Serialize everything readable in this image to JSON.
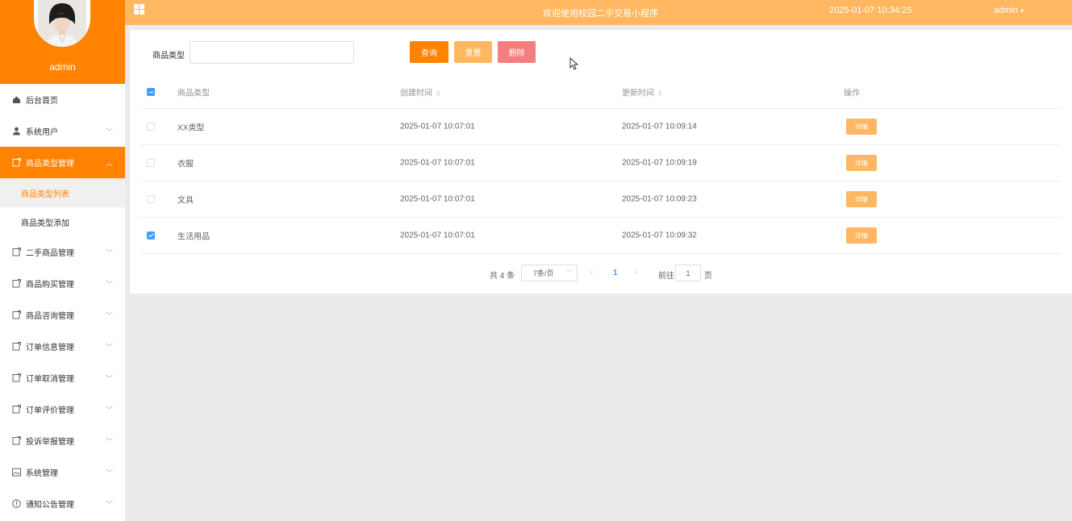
{
  "sidebar": {
    "username": "admin",
    "menu": [
      {
        "label": "后台首页",
        "icon": "home-icon",
        "has_children": false
      },
      {
        "label": "系统用户",
        "icon": "user-icon",
        "has_children": true
      },
      {
        "label": "商品类型管理",
        "icon": "tag-icon",
        "has_children": true,
        "expanded": true
      },
      {
        "label": "二手商品管理",
        "icon": "tag-icon",
        "has_children": true
      },
      {
        "label": "商品购买管理",
        "icon": "tag-icon",
        "has_children": true
      },
      {
        "label": "商品咨询管理",
        "icon": "tag-icon",
        "has_children": true
      },
      {
        "label": "订单信息管理",
        "icon": "tag-icon",
        "has_children": true
      },
      {
        "label": "订单取消管理",
        "icon": "tag-icon",
        "has_children": true
      },
      {
        "label": "订单评价管理",
        "icon": "tag-icon",
        "has_children": true
      },
      {
        "label": "投诉举报管理",
        "icon": "tag-icon",
        "has_children": true
      },
      {
        "label": "系统管理",
        "icon": "picture-icon",
        "has_children": true
      },
      {
        "label": "通知公告管理",
        "icon": "info-circle-icon",
        "has_children": true
      }
    ],
    "submenu": [
      {
        "label": "商品类型列表",
        "active": true
      },
      {
        "label": "商品类型添加",
        "active": false
      }
    ]
  },
  "topbar": {
    "welcome": "欢迎使用校园二手交易小程序",
    "clock": "2025-01-07 10:34:25",
    "user": "admin"
  },
  "search": {
    "label": "商品类型",
    "value": "",
    "buttons": {
      "query": "查询",
      "reset": "重置",
      "delete": "删除"
    }
  },
  "table": {
    "headers": {
      "type": "商品类型",
      "created": "创建时间",
      "updated": "更新时间",
      "op": "操作"
    },
    "detail_label": "详情",
    "rows": [
      {
        "type": "XX类型",
        "created": "2025-01-07 10:07:01",
        "updated": "2025-01-07 10:09:14",
        "checked": false
      },
      {
        "type": "衣服",
        "created": "2025-01-07 10:07:01",
        "updated": "2025-01-07 10:09:19",
        "checked": false
      },
      {
        "type": "文具",
        "created": "2025-01-07 10:07:01",
        "updated": "2025-01-07 10:09:23",
        "checked": false
      },
      {
        "type": "生活用品",
        "created": "2025-01-07 10:07:01",
        "updated": "2025-01-07 10:09:32",
        "checked": true
      }
    ]
  },
  "pagination": {
    "total": "共 4 条",
    "page_size": "7条/页",
    "current": "1",
    "goto_label": "前往",
    "goto_value": "1",
    "page_label": "页"
  },
  "colors": {
    "primary": "#ff8200",
    "light": "#ffb861",
    "danger": "#f47d7d",
    "link": "#409eff"
  }
}
